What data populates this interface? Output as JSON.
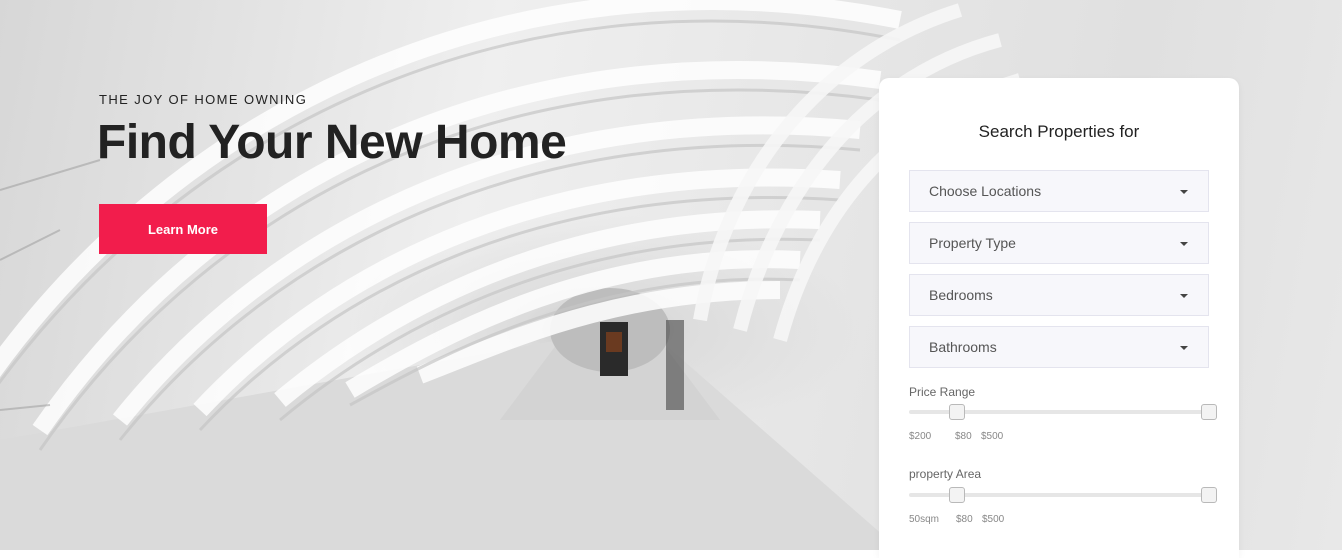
{
  "hero": {
    "eyebrow": "THE JOY OF HOME OWNING",
    "headline": "Find Your New Home",
    "cta_label": "Learn More",
    "accent_color": "#f21d4c"
  },
  "search": {
    "title": "Search Properties for",
    "selects": [
      {
        "label": "Choose Locations",
        "icon": "chevron-down-icon"
      },
      {
        "label": "Property Type",
        "icon": "chevron-down-icon"
      },
      {
        "label": "Bedrooms",
        "icon": "chevron-down-icon"
      },
      {
        "label": "Bathrooms",
        "icon": "chevron-down-icon"
      }
    ],
    "price_range": {
      "label": "Price Range",
      "min_text": "$200",
      "low_text": "$80",
      "high_text": "$500"
    },
    "area_range": {
      "label": "property Area",
      "min_text": "50sqm",
      "low_text": "$80",
      "high_text": "$500"
    }
  }
}
